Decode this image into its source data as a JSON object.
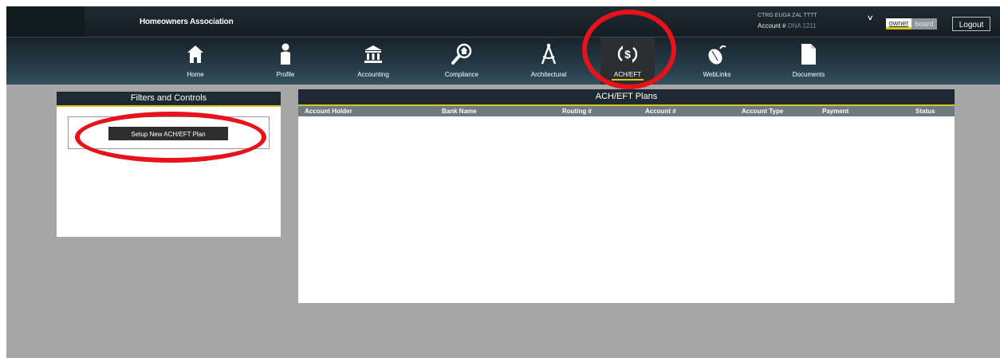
{
  "header": {
    "association_name": "Homeowners Association",
    "account_name": "CTRG EUGA ZAL TTTT",
    "account_label": "Account #",
    "account_number": "DNA 1211",
    "roles": {
      "owner": "owner",
      "board": "board",
      "active": "owner"
    },
    "logout_label": "Logout"
  },
  "nav": {
    "items": [
      {
        "label": "Home",
        "icon": "home-icon"
      },
      {
        "label": "Profile",
        "icon": "person-icon"
      },
      {
        "label": "Accounting",
        "icon": "bank-icon"
      },
      {
        "label": "Compliance",
        "icon": "magnifier-house-icon"
      },
      {
        "label": "Architectural",
        "icon": "compass-icon"
      },
      {
        "label": "ACH/EFT",
        "icon": "dollar-cycle-icon",
        "active": true
      },
      {
        "label": "WebLinks",
        "icon": "mouse-icon"
      },
      {
        "label": "Documents",
        "icon": "document-icon"
      }
    ]
  },
  "filters": {
    "title": "Filters and Controls",
    "setup_button": "Setup New ACH/EFT Plan"
  },
  "plans": {
    "title": "ACH/EFT Plans",
    "columns": [
      "Account Holder",
      "Bank Name",
      "Routing #",
      "Account #",
      "Account Type",
      "Payment",
      "Status"
    ],
    "rows": []
  },
  "annotations": {
    "color": "#e8121a",
    "targets": [
      "ACH/EFT",
      "Setup New ACH/EFT Plan"
    ]
  },
  "colors": {
    "accent": "#e0c31a",
    "header_bg": "#1d2a31",
    "page_bg": "#a6a6a6"
  }
}
